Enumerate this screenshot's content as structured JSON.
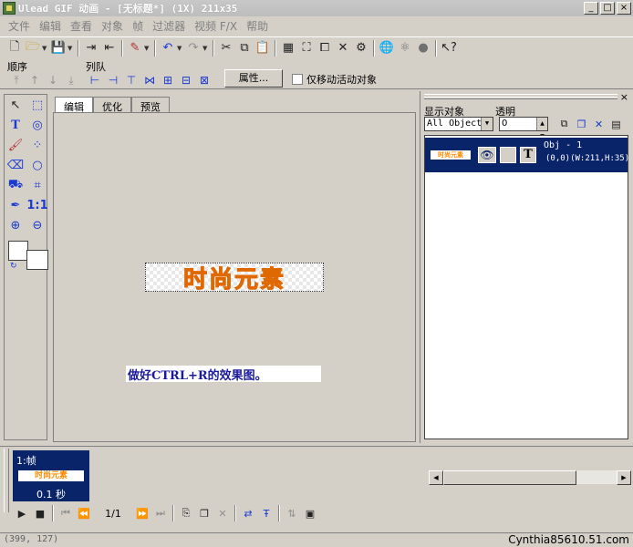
{
  "window": {
    "title": "Ulead GIF 动画 - [无标题*] (1X) 211x35",
    "minimize": "_",
    "maximize": "□",
    "close": "×"
  },
  "menu": [
    "文件",
    "编辑",
    "查看",
    "对象",
    "帧",
    "过滤器",
    "视频 F/X",
    "帮助"
  ],
  "toolbar2": {
    "order_label": "顺序",
    "queue_label": "列队",
    "properties_button": "属性...",
    "move_active_only_label": "仅移动活动对象"
  },
  "tabs": [
    {
      "label": "编辑",
      "active": true
    },
    {
      "label": "优化",
      "active": false
    },
    {
      "label": "预览",
      "active": false
    }
  ],
  "canvas": {
    "art_text": "时尚元素",
    "note_text": "做好CTRL+R的效果图。"
  },
  "object_panel": {
    "show_objects_label": "显示对象",
    "opacity_label": "透明",
    "filter_value": "All Objects",
    "opacity_value": "0",
    "close": "×",
    "object": {
      "thumb_text": "时尚元素",
      "type_icon_text": "T",
      "name": "Obj - 1",
      "geometry": "(0,0)(W:211,H:35)"
    }
  },
  "frame_panel": {
    "frame_label": "1:帧",
    "thumb_text": "时尚元素",
    "delay": "0.1 秒",
    "counter": "1/1"
  },
  "status": {
    "coords": "(399, 127)"
  },
  "watermark": "Cynthia85610.51.com",
  "colors": {
    "art_orange": "#ff8a00",
    "note_blue": "#1a1aa0",
    "selection_navy": "#0a246a",
    "chrome": "#d4d0c8"
  }
}
